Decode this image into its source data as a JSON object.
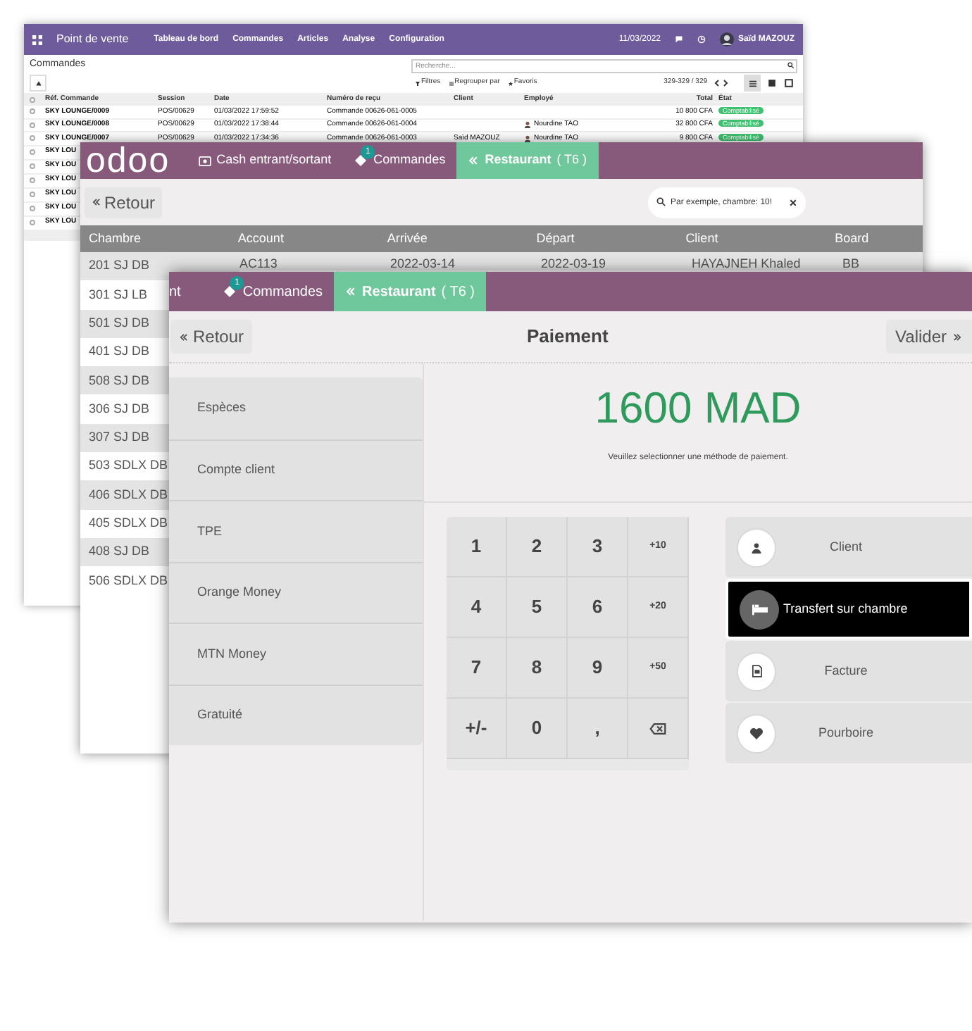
{
  "orders_window": {
    "app_title": "Point de vente",
    "menu": [
      "Tableau de bord",
      "Commandes",
      "Articles",
      "Analyse",
      "Configuration"
    ],
    "date": "11/03/2022",
    "user": "Saïd MAZOUZ",
    "page_title": "Commandes",
    "search": {
      "placeholder": "Recherche..."
    },
    "filters": [
      "Filtres",
      "Regrouper par",
      "Favoris"
    ],
    "pager": "329-329 / 329",
    "all_checked": false,
    "columns": [
      "Réf. Commande",
      "Session",
      "Date",
      "Numéro de reçu",
      "Client",
      "Employé",
      "Total",
      "État"
    ],
    "rows": [
      {
        "ref": "SKY LOUNGE/0009",
        "session": "POS/00629",
        "date": "01/03/2022 17:59:52",
        "receipt": "Commande 00626-061-0005",
        "client": "",
        "employee": "",
        "total": "10 800 CFA",
        "state": "Comptabilisé",
        "checked": false
      },
      {
        "ref": "SKY LOUNGE/0008",
        "session": "POS/00629",
        "date": "01/03/2022 17:38:44",
        "receipt": "Commande 00626-061-0004",
        "client": "",
        "employee": "Nourdine TAO",
        "total": "32 800 CFA",
        "state": "Comptabilisé",
        "checked": false
      },
      {
        "ref": "SKY LOUNGE/0007",
        "session": "POS/00629",
        "date": "01/03/2022 17:34:36",
        "receipt": "Commande 00626-061-0003",
        "client": "Saïd MAZOUZ",
        "employee": "Nourdine TAO",
        "total": "9 800 CFA",
        "state": "Comptabilisé",
        "checked": false
      }
    ],
    "partial_rows": [
      {
        "ref": "SKY LOU",
        "checked": false
      },
      {
        "ref": "SKY LOU",
        "checked": false
      },
      {
        "ref": "SKY LOU",
        "checked": false
      },
      {
        "ref": "SKY LOU",
        "checked": false
      },
      {
        "ref": "SKY LOU",
        "checked": false
      },
      {
        "ref": "SKY LOU",
        "checked": false
      }
    ]
  },
  "rooms_window": {
    "logo": "odoo",
    "tabs": [
      {
        "label": "Cash entrant/sortant",
        "kind": "cash",
        "selected": false
      },
      {
        "label": "Commandes",
        "kind": "orders",
        "badge": "1",
        "selected": false
      },
      {
        "label": "Restaurant",
        "extra": "( T6 )",
        "kind": "restaurant",
        "selected": true
      }
    ],
    "back_button": "Retour",
    "search": {
      "placeholder": "Par exemple, chambre: 10!"
    },
    "columns": [
      "Chambre",
      "Account",
      "Arrivée",
      "Départ",
      "Client",
      "Board"
    ],
    "rows": [
      {
        "cells": [
          "201 SJ DB",
          "AC113",
          "2022-03-14",
          "2022-03-19",
          "HAYAJNEH Khaled",
          "BB"
        ]
      },
      {
        "cells": [
          "301 SJ LB"
        ]
      },
      {
        "cells": [
          "501 SJ DB"
        ]
      },
      {
        "cells": [
          "401 SJ DB"
        ]
      },
      {
        "cells": [
          "508 SJ DB"
        ]
      },
      {
        "cells": [
          "306 SJ DB"
        ]
      },
      {
        "cells": [
          "307 SJ DB"
        ]
      },
      {
        "cells": [
          "503 SDLX DB"
        ]
      },
      {
        "cells": [
          "406 SDLX DB"
        ]
      },
      {
        "cells": [
          "405 SDLX DB"
        ]
      },
      {
        "cells": [
          "408 SJ DB"
        ]
      },
      {
        "cells": [
          "506 SDLX DB"
        ]
      }
    ]
  },
  "payment_window": {
    "tabs": [
      {
        "label": "nt",
        "kind": "cash",
        "selected": false
      },
      {
        "label": "Commandes",
        "kind": "orders",
        "badge": "1",
        "selected": false
      },
      {
        "label": "Restaurant",
        "extra": "( T6 )",
        "kind": "restaurant",
        "selected": true
      }
    ],
    "back_button": "Retour",
    "title": "Paiement",
    "validate_button": "Valider",
    "methods": [
      "Espèces",
      "Compte client",
      "TPE",
      "Orange Money",
      "MTN Money",
      "Gratuité"
    ],
    "amount": "1600 MAD",
    "hint": "Veuillez selectionner une méthode de paiement.",
    "keys": [
      {
        "kind": "digit",
        "label": "1"
      },
      {
        "kind": "digit",
        "label": "2"
      },
      {
        "kind": "digit",
        "label": "3"
      },
      {
        "kind": "small",
        "label": "+10"
      },
      {
        "kind": "digit",
        "label": "4"
      },
      {
        "kind": "digit",
        "label": "5"
      },
      {
        "kind": "digit",
        "label": "6"
      },
      {
        "kind": "small",
        "label": "+20"
      },
      {
        "kind": "digit",
        "label": "7"
      },
      {
        "kind": "digit",
        "label": "8"
      },
      {
        "kind": "digit",
        "label": "9"
      },
      {
        "kind": "small",
        "label": "+50"
      },
      {
        "kind": "digit",
        "label": "+/-"
      },
      {
        "kind": "digit",
        "label": "0"
      },
      {
        "kind": "digit",
        "label": ","
      },
      {
        "kind": "backspace"
      }
    ],
    "options": [
      {
        "label": "Client",
        "kind": "user",
        "selected": false
      },
      {
        "label": "Transfert sur chambre",
        "kind": "bed",
        "selected": true
      },
      {
        "label": "Facture",
        "kind": "invoice",
        "selected": false
      },
      {
        "label": "Pourboire",
        "kind": "heart",
        "selected": false
      }
    ]
  }
}
